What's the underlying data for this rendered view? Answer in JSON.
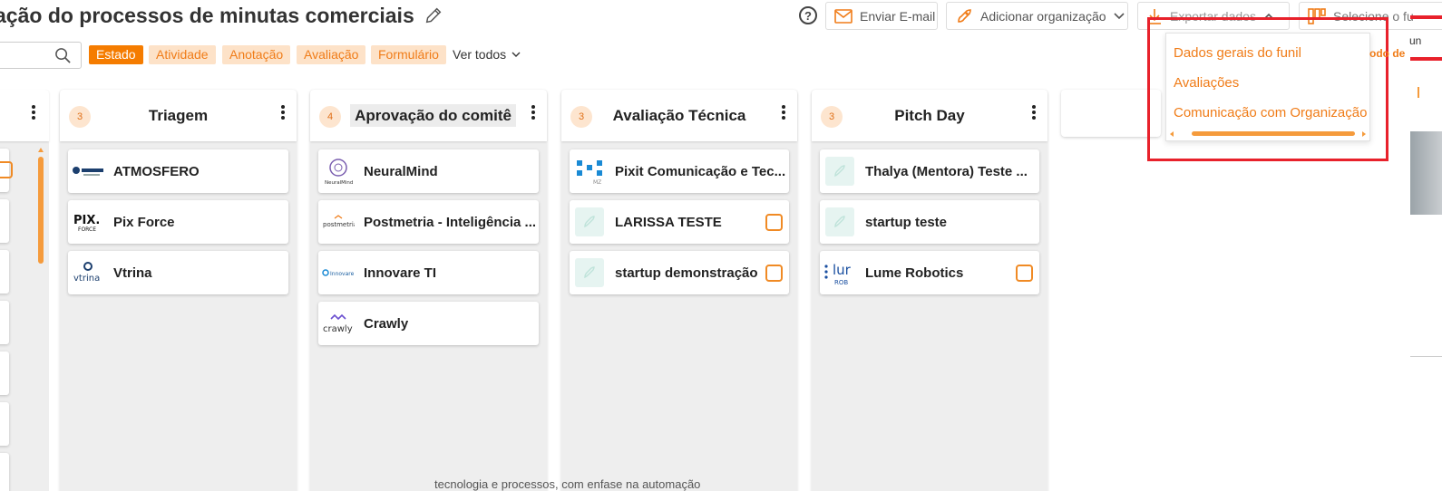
{
  "header": {
    "title": "ação do processos de minutas comerciais",
    "buttons": {
      "email": "Enviar E-mail",
      "add_org": "Adicionar organização",
      "export": "Exportar dados",
      "funnel": "Selecione o fu"
    }
  },
  "filters": {
    "chips": [
      "Estado",
      "Atividade",
      "Anotação",
      "Avaliação",
      "Formulário"
    ],
    "active": "Estado",
    "see_all": "Ver todos"
  },
  "columns": [
    {
      "count": "3",
      "title": "Triagem",
      "cards": [
        {
          "name": "ATMOSFERO",
          "logo": "atmosfero-logo",
          "form": false
        },
        {
          "name": "Pix Force",
          "logo": "pixforce-logo",
          "form": false
        },
        {
          "name": "Vtrina",
          "logo": "vtrina-logo",
          "form": false
        }
      ]
    },
    {
      "count": "4",
      "title": "Aprovação do comitê",
      "cards": [
        {
          "name": "NeuralMind",
          "logo": "neuralmind-logo",
          "form": false
        },
        {
          "name": "Postmetria - Inteligência ...",
          "logo": "postmetria-logo",
          "form": false
        },
        {
          "name": "Innovare TI",
          "logo": "innovare-logo",
          "form": false
        },
        {
          "name": "Crawly",
          "logo": "crawly-logo",
          "form": false
        }
      ]
    },
    {
      "count": "3",
      "title": "Avaliação Técnica",
      "cards": [
        {
          "name": "Pixit Comunicação e Tec...",
          "logo": "pixit-logo",
          "form": false
        },
        {
          "name": "LARISSA TESTE",
          "logo": "rocket-placeholder-logo",
          "form": true
        },
        {
          "name": "startup demonstração",
          "logo": "rocket-placeholder-logo",
          "form": true
        }
      ]
    },
    {
      "count": "3",
      "title": "Pitch Day",
      "cards": [
        {
          "name": "Thalya (Mentora) Teste ...",
          "logo": "rocket-placeholder-logo",
          "form": false
        },
        {
          "name": "startup teste",
          "logo": "rocket-placeholder-logo",
          "form": false
        },
        {
          "name": "Lume Robotics",
          "logo": "lume-logo",
          "form": true
        }
      ]
    }
  ],
  "export_dropdown": {
    "items": [
      "Dados gerais do funil",
      "Avaliações",
      "Comunicação com Organização"
    ]
  },
  "edge": {
    "right_text": "un",
    "right_orange": "odo de",
    "bottom_text": "tecnologia e processos, com enfase na automação"
  },
  "colors": {
    "accent": "#f57c00",
    "chip_bg": "#fde2c8",
    "highlight": "#e8212b",
    "column_bg": "#eeeeee"
  }
}
